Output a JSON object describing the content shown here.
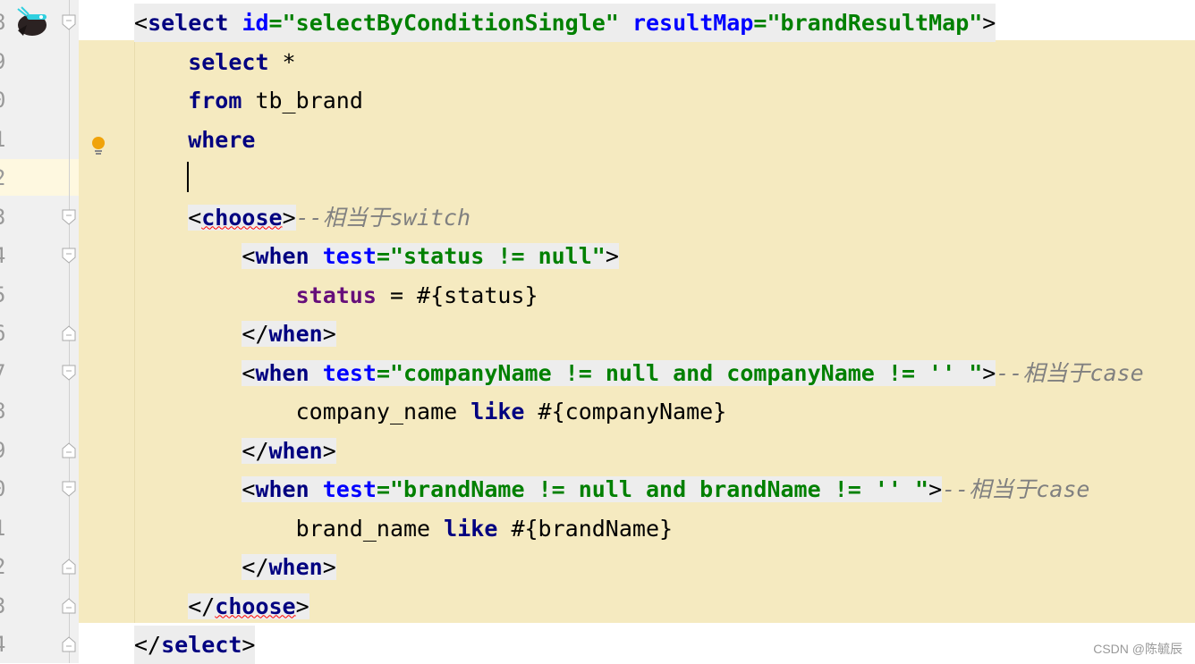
{
  "gutter": {
    "line_numbers": [
      "8",
      "9",
      "0",
      "1",
      "2",
      "3",
      "4",
      "5",
      "6",
      "7",
      "8",
      "9",
      "0",
      "1",
      "2",
      "3",
      "4"
    ],
    "current_line": 4
  },
  "lines": [
    {
      "indent": 0,
      "hl": true,
      "tokens": [
        {
          "t": "<",
          "c": "pl"
        },
        {
          "t": "select",
          "c": "tag"
        },
        {
          "t": " ",
          "c": "pl"
        },
        {
          "t": "id",
          "c": "attr"
        },
        {
          "t": "=\"selectByConditionSingle\"",
          "c": "val"
        },
        {
          "t": " ",
          "c": "pl"
        },
        {
          "t": "resultMap",
          "c": "attr"
        },
        {
          "t": "=\"brandResultMap\"",
          "c": "val"
        },
        {
          "t": ">",
          "c": "pl"
        }
      ]
    },
    {
      "indent": 1,
      "tokens": [
        {
          "t": "select",
          "c": "kw"
        },
        {
          "t": " *",
          "c": "pl"
        }
      ]
    },
    {
      "indent": 1,
      "tokens": [
        {
          "t": "from",
          "c": "kw"
        },
        {
          "t": " tb_brand",
          "c": "pl"
        }
      ]
    },
    {
      "indent": 1,
      "tokens": [
        {
          "t": "where",
          "c": "kw"
        }
      ]
    },
    {
      "indent": 1,
      "tokens": []
    },
    {
      "indent": 1,
      "tokens": [
        {
          "t": "<",
          "c": "pl",
          "h": 1
        },
        {
          "t": "choose",
          "c": "tag err",
          "h": 1
        },
        {
          "t": ">",
          "c": "pl",
          "h": 1
        },
        {
          "t": "--相当于switch",
          "c": "cmt"
        }
      ]
    },
    {
      "indent": 2,
      "tokens": [
        {
          "t": "<",
          "c": "pl",
          "h": 1
        },
        {
          "t": "when",
          "c": "tag",
          "h": 1
        },
        {
          "t": " ",
          "c": "pl",
          "h": 1
        },
        {
          "t": "test",
          "c": "attr",
          "h": 1
        },
        {
          "t": "=\"status != null\"",
          "c": "val",
          "h": 1
        },
        {
          "t": ">",
          "c": "pl",
          "h": 1
        }
      ]
    },
    {
      "indent": 3,
      "tokens": [
        {
          "t": "status",
          "c": "prop"
        },
        {
          "t": " = #{status}",
          "c": "pl"
        }
      ]
    },
    {
      "indent": 2,
      "tokens": [
        {
          "t": "</",
          "c": "pl",
          "h": 1
        },
        {
          "t": "when",
          "c": "tag",
          "h": 1
        },
        {
          "t": ">",
          "c": "pl",
          "h": 1
        }
      ]
    },
    {
      "indent": 2,
      "tokens": [
        {
          "t": "<",
          "c": "pl",
          "h": 1
        },
        {
          "t": "when",
          "c": "tag",
          "h": 1
        },
        {
          "t": " ",
          "c": "pl",
          "h": 1
        },
        {
          "t": "test",
          "c": "attr",
          "h": 1
        },
        {
          "t": "=\"companyName != null and companyName != '' \"",
          "c": "val",
          "h": 1
        },
        {
          "t": ">",
          "c": "pl",
          "h": 1
        },
        {
          "t": "--相当于case",
          "c": "cmt"
        }
      ]
    },
    {
      "indent": 3,
      "tokens": [
        {
          "t": "company_name ",
          "c": "pl"
        },
        {
          "t": "like",
          "c": "kw"
        },
        {
          "t": " #{companyName}",
          "c": "pl"
        }
      ]
    },
    {
      "indent": 2,
      "tokens": [
        {
          "t": "</",
          "c": "pl",
          "h": 1
        },
        {
          "t": "when",
          "c": "tag",
          "h": 1
        },
        {
          "t": ">",
          "c": "pl",
          "h": 1
        }
      ]
    },
    {
      "indent": 2,
      "tokens": [
        {
          "t": "<",
          "c": "pl",
          "h": 1
        },
        {
          "t": "when",
          "c": "tag",
          "h": 1
        },
        {
          "t": " ",
          "c": "pl",
          "h": 1
        },
        {
          "t": "test",
          "c": "attr",
          "h": 1
        },
        {
          "t": "=\"brandName != null and brandName != '' \"",
          "c": "val",
          "h": 1
        },
        {
          "t": ">",
          "c": "pl",
          "h": 1
        },
        {
          "t": "--相当于case",
          "c": "cmt"
        }
      ]
    },
    {
      "indent": 3,
      "tokens": [
        {
          "t": "brand_name ",
          "c": "pl"
        },
        {
          "t": "like",
          "c": "kw"
        },
        {
          "t": " #{brandName}",
          "c": "pl"
        }
      ]
    },
    {
      "indent": 2,
      "tokens": [
        {
          "t": "</",
          "c": "pl",
          "h": 1
        },
        {
          "t": "when",
          "c": "tag",
          "h": 1
        },
        {
          "t": ">",
          "c": "pl",
          "h": 1
        }
      ]
    },
    {
      "indent": 1,
      "tokens": [
        {
          "t": "</",
          "c": "pl",
          "h": 1
        },
        {
          "t": "choose",
          "c": "tag err",
          "h": 1
        },
        {
          "t": ">",
          "c": "pl",
          "h": 1
        }
      ]
    },
    {
      "indent": 0,
      "hl": true,
      "tokens": [
        {
          "t": "</",
          "c": "pl"
        },
        {
          "t": "select",
          "c": "tag"
        },
        {
          "t": ">",
          "c": "pl"
        }
      ]
    }
  ],
  "folds": {
    "start": [
      0,
      5,
      6,
      9,
      12
    ],
    "end": [
      8,
      11,
      14,
      15,
      16
    ]
  },
  "icons": {
    "avatar": "bird-avatar-icon",
    "bulb": "lightbulb-icon"
  },
  "colors": {
    "tag": "#000080",
    "attribute": "#0000ff",
    "value": "#008000",
    "comment": "#808080",
    "highlight": "#f5eac0"
  },
  "watermark": "CSDN @陈毓辰"
}
